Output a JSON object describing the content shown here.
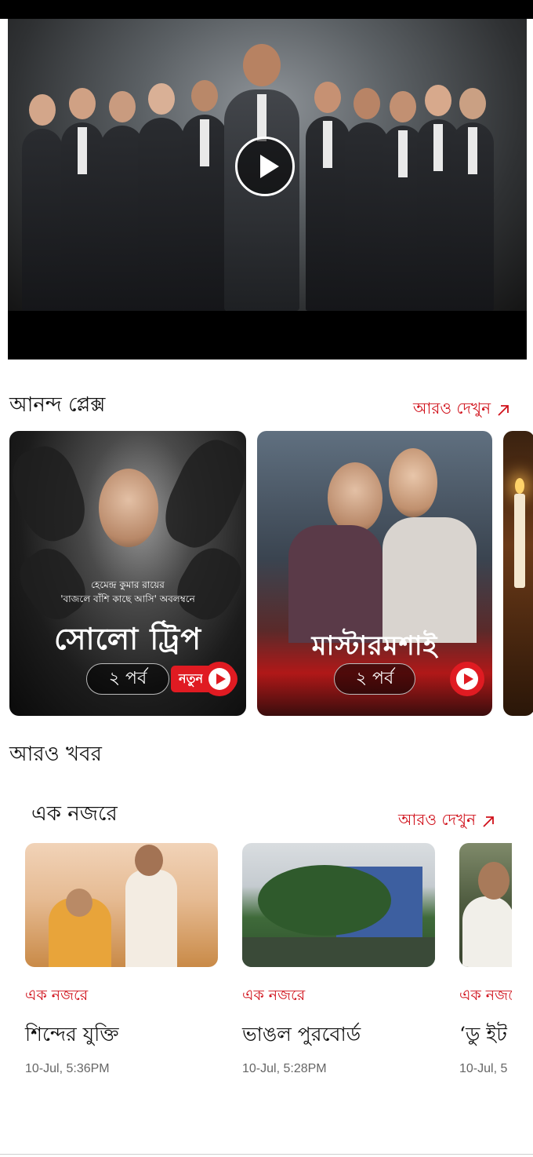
{
  "hero": {
    "video_label": "play-video"
  },
  "plex_section": {
    "title": "আনন্দ প্লেক্স",
    "more_label": "আরও দেখুন",
    "posters": [
      {
        "subtitle_line1": "হেমেন্দ্র কুমার রায়ের",
        "subtitle_line2": "'বাজলে বাঁশি কাছে আসি' অবলম্বনে",
        "title": "সোলো ট্রিপ",
        "episodes": "২ পর্ব",
        "badge": "নতুন"
      },
      {
        "title": "মাস্টারমশাই",
        "episodes": "২ পর্ব"
      }
    ]
  },
  "more_news": {
    "title": "আরও খবর"
  },
  "glance_section": {
    "title": "এক নজরে",
    "more_label": "আরও দেখুন",
    "cards": [
      {
        "category": "এক নজরে",
        "headline": "শিন্দের যুক্তি",
        "time": "10-Jul, 5:36PM"
      },
      {
        "category": "এক নজরে",
        "headline": "ভাঙল পুরবোর্ড",
        "time": "10-Jul, 5:28PM"
      },
      {
        "category": "এক নজরে",
        "headline": "‘ডু ইট",
        "time": "10-Jul, 5"
      }
    ]
  },
  "colors": {
    "accent": "#d0101a",
    "badge_red": "#e01b22"
  },
  "icons": [
    "play-icon",
    "arrow-up-right-icon"
  ]
}
